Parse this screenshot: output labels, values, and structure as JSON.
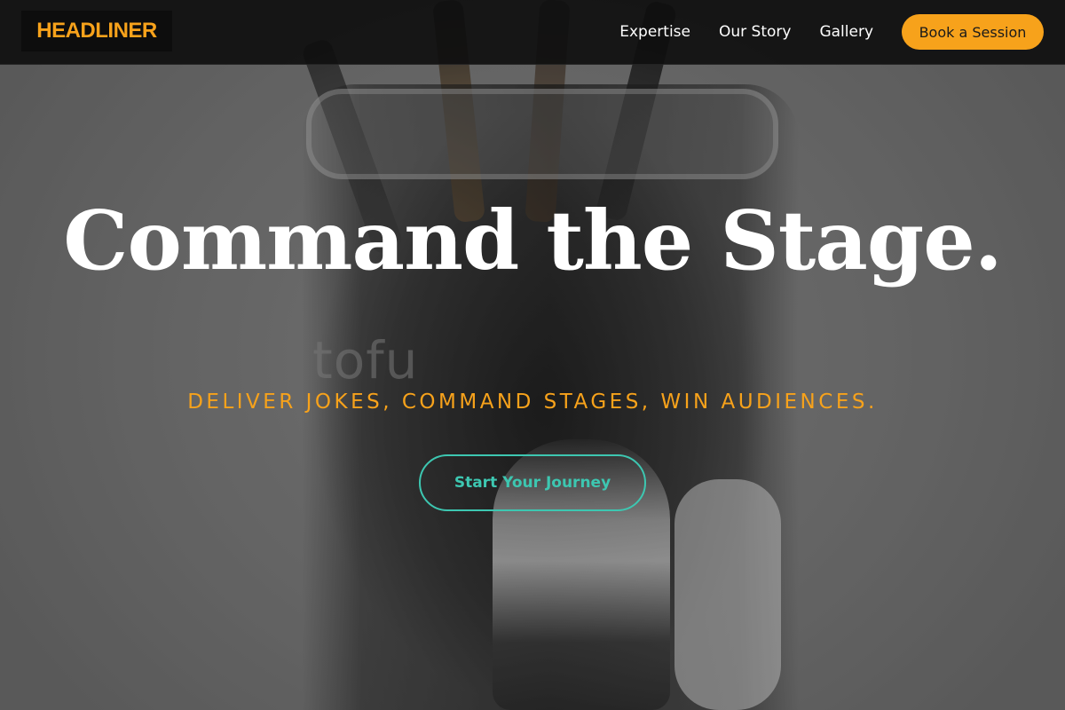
{
  "header": {
    "logo_text": "HEADLINER",
    "nav": [
      {
        "label": "Expertise"
      },
      {
        "label": "Our Story"
      },
      {
        "label": "Gallery"
      }
    ],
    "book_label": "Book a Session"
  },
  "hero": {
    "title": "Command the Stage.",
    "subtitle": "DELIVER JOKES, COMMAND STAGES, WIN AUDIENCES.",
    "cta_label": "Start Your Journey",
    "watermark": "tofu"
  },
  "colors": {
    "accent": "#f7a21b",
    "cta": "#3dc7b1",
    "header_bg": "#0f0f0f"
  }
}
